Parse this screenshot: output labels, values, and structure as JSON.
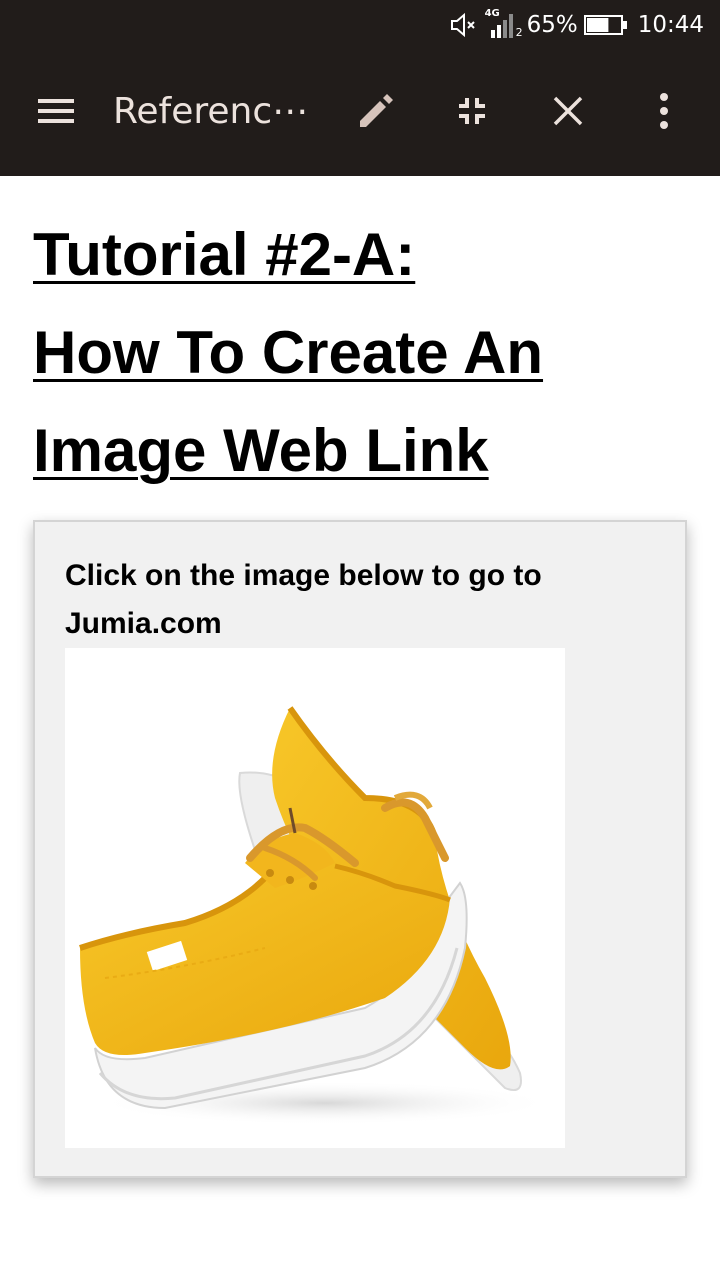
{
  "status_bar": {
    "network": "4G",
    "sim_slot": "2",
    "battery": "65%",
    "battery_level": 0.65,
    "time": "10:44",
    "icons": [
      "mute-icon",
      "signal-icon",
      "battery-icon"
    ]
  },
  "app_bar": {
    "title": "Referenc⋯",
    "icons": [
      "menu-icon",
      "pencil-icon",
      "collapse-icon",
      "close-icon",
      "more-vert-icon"
    ],
    "color": "#211c1a"
  },
  "content": {
    "heading_lines": [
      "Tutorial #2-A:",
      "How To Create An",
      "Image Web Link"
    ],
    "card_text_lines": [
      "Click on the image below to go to",
      "Jumia.com"
    ],
    "image": "yellow-sneakers-image"
  },
  "colors": {
    "app_bar": "#211c1a",
    "card_background": "#f1f1f1",
    "shoe_yellow": "#f3b617"
  }
}
